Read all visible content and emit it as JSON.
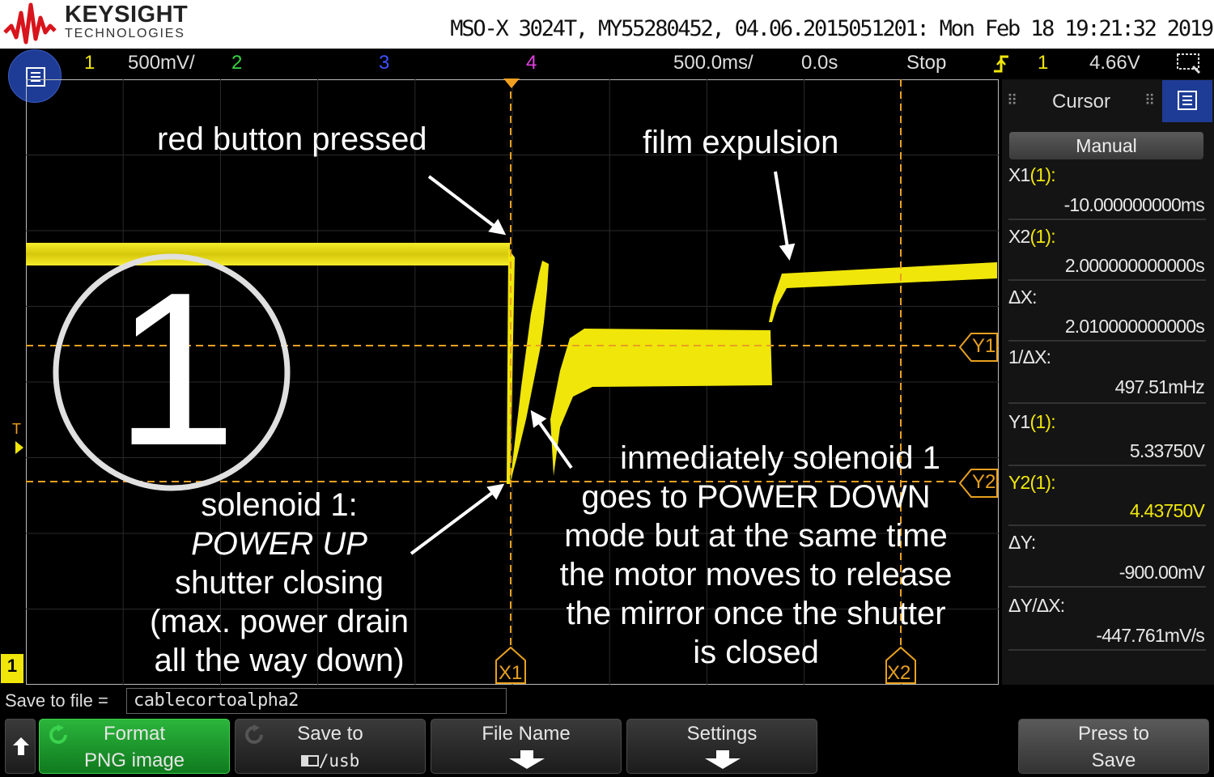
{
  "header": {
    "brand": "KEYSIGHT",
    "brand_sub": "TECHNOLOGIES",
    "device_info": "MSO-X 3024T, MY55280452, 04.06.2015051201: Mon Feb 18 19:21:32 2019"
  },
  "status_bar": {
    "ch1": "1",
    "ch1_scale": "500mV/",
    "ch2": "2",
    "ch3": "3",
    "ch4": "4",
    "timebase": "500.0ms/",
    "delay": "0.0s",
    "run_state": "Stop",
    "trigger_channel": "1",
    "trigger_level": "4.66V"
  },
  "cursor_panel": {
    "title": "Cursor",
    "mode": "Manual",
    "x1_label": "X1",
    "x1_ch": "(1):",
    "x1_value": "-10.000000000ms",
    "x2_label": "X2",
    "x2_ch": "(1):",
    "x2_value": "2.000000000000s",
    "dx_label": "ΔX:",
    "dx_value": "2.010000000000s",
    "inv_dx_label": "1/ΔX:",
    "inv_dx_value": "497.51mHz",
    "y1_label": "Y1",
    "y1_ch": "(1):",
    "y1_value": "5.33750V",
    "y2_label": "Y2(1):",
    "y2_value": "4.43750V",
    "dy_label": "ΔY:",
    "dy_value": "-900.00mV",
    "dydx_label": "ΔY/ΔX:",
    "dydx_value": "-447.761mV/s"
  },
  "markers": {
    "x1": "X1",
    "x2": "X2",
    "y1": "Y1",
    "y2": "Y2",
    "trigger_t": "T",
    "ch1_ground": "1"
  },
  "annotations": {
    "red_button": "red button pressed",
    "film_expulsion": "film expulsion",
    "circle_number": "1",
    "solenoid_lines": [
      "solenoid 1:",
      "POWER UP",
      "shutter closing",
      "(max. power drain",
      "all the way down)"
    ],
    "immediately_lines": [
      "inmediately solenoid 1",
      "goes to POWER DOWN",
      "mode but at the same time",
      "the motor moves to release",
      "the mirror once the shutter",
      "is closed"
    ]
  },
  "save_bar": {
    "label": "Save to file =",
    "filename": "cablecortoalpha2"
  },
  "softkeys": {
    "format_l1": "Format",
    "format_l2": "PNG image",
    "saveto_l1": "Save to",
    "saveto_l2": "/usb",
    "filename_l1": "File Name",
    "settings_l1": "Settings",
    "press_l1": "Press to",
    "press_l2": "Save"
  },
  "colors": {
    "ch1": "#f0e60a",
    "ch2": "#37d241",
    "ch3": "#4050ff",
    "ch4": "#e040e0",
    "cursor": "#e8a020",
    "softkey_active": "#1b9a2c"
  }
}
